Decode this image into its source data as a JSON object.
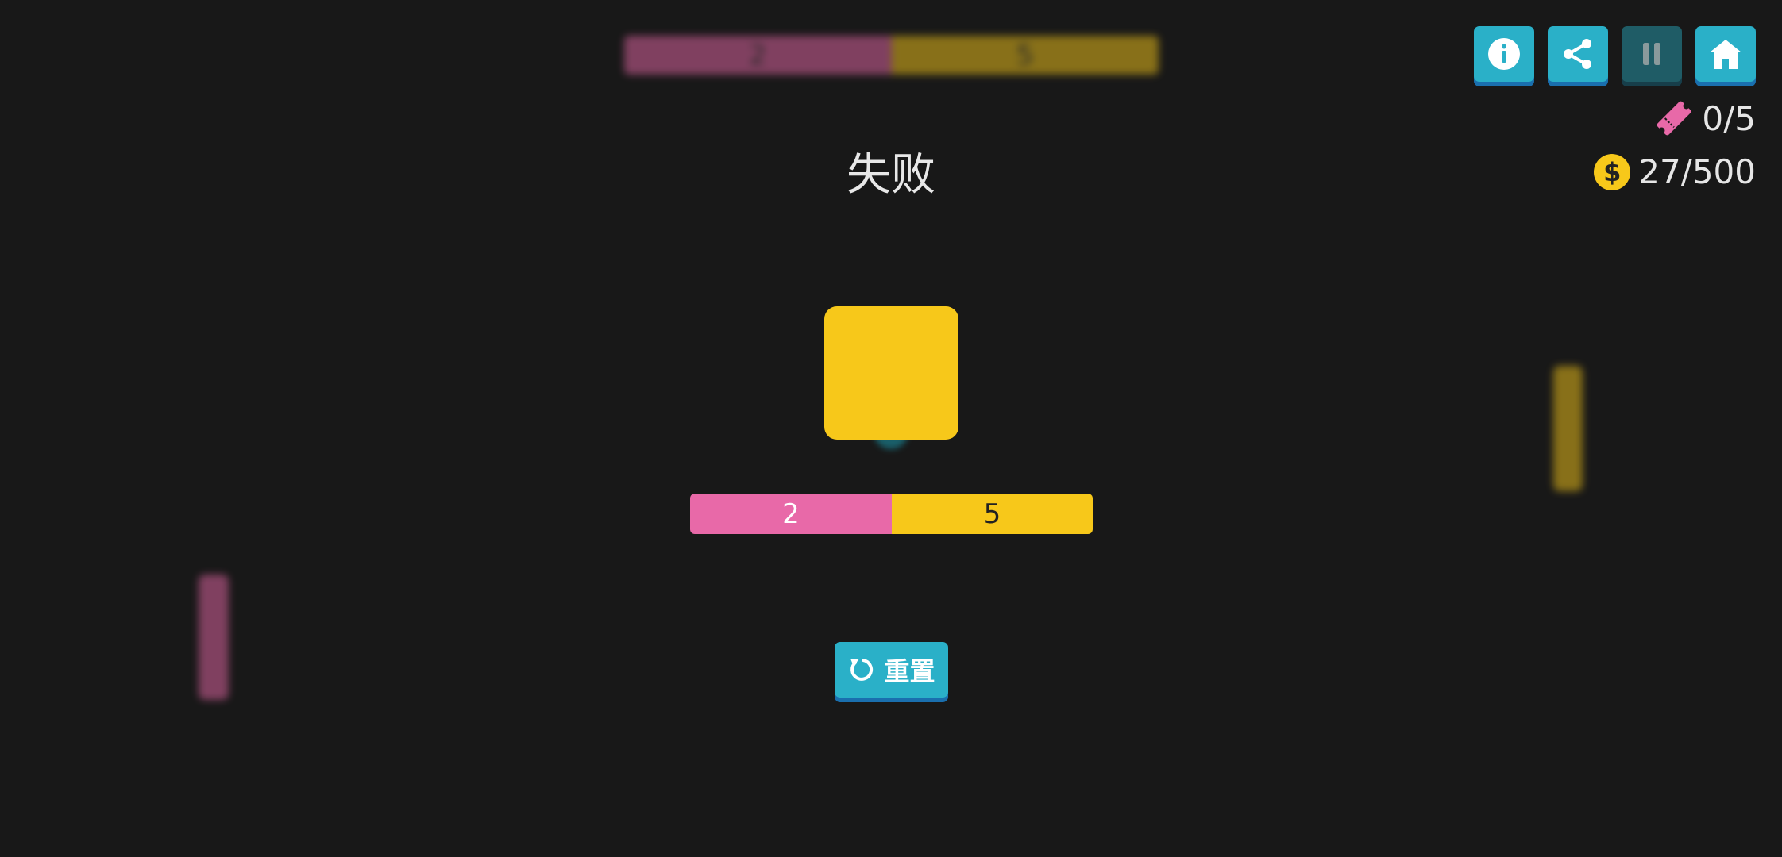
{
  "background_game": {
    "top_bar": {
      "left_value": "2",
      "right_value": "5"
    }
  },
  "controls": {
    "info": "info-icon",
    "share": "share-icon",
    "pause": "pause-icon",
    "home": "home-icon"
  },
  "counters": {
    "tickets": "0/5",
    "coins": "27/500",
    "coin_symbol": "$"
  },
  "status_title": "失败",
  "score_bar": {
    "left_value": "2",
    "right_value": "5"
  },
  "reset_button": {
    "label": "重置",
    "icon": "reset-icon"
  },
  "colors": {
    "background": "#181818",
    "pink": "#e869a8",
    "yellow": "#f7c81a",
    "teal_button": "#2ab0c8",
    "button_shadow": "#1a6fae"
  }
}
